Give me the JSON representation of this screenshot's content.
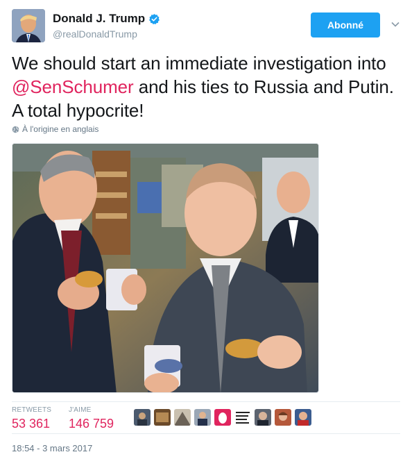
{
  "author": {
    "display_name": "Donald J. Trump",
    "handle": "@realDonaldTrump",
    "verified": true,
    "avatar_icon": "profile-photo"
  },
  "follow_button": {
    "label": "Abonné",
    "color": "#1da1f2"
  },
  "menu_icon": "chevron-down-icon",
  "tweet": {
    "text_before": "We should start an immediate investigation into ",
    "mention": "@SenSchumer",
    "text_after": " and his ties to Russia and Putin. A total hypocrite!",
    "mention_color": "#e0245e"
  },
  "translation_note": {
    "icon": "globe-icon",
    "text": "À l'origine en anglais"
  },
  "media": {
    "type": "photo"
  },
  "stats": {
    "retweets_label": "RETWEETS",
    "retweets_value": "53 361",
    "likes_label": "J'AIME",
    "likes_value": "146 759",
    "value_color": "#e0245e"
  },
  "likers": [
    {
      "icon": "user-avatar"
    },
    {
      "icon": "user-avatar"
    },
    {
      "icon": "user-avatar"
    },
    {
      "icon": "user-avatar"
    },
    {
      "icon": "user-avatar"
    },
    {
      "icon": "user-avatar"
    },
    {
      "icon": "user-avatar"
    },
    {
      "icon": "user-avatar"
    },
    {
      "icon": "user-avatar"
    }
  ],
  "timestamp": "18:54 - 3 mars 2017"
}
